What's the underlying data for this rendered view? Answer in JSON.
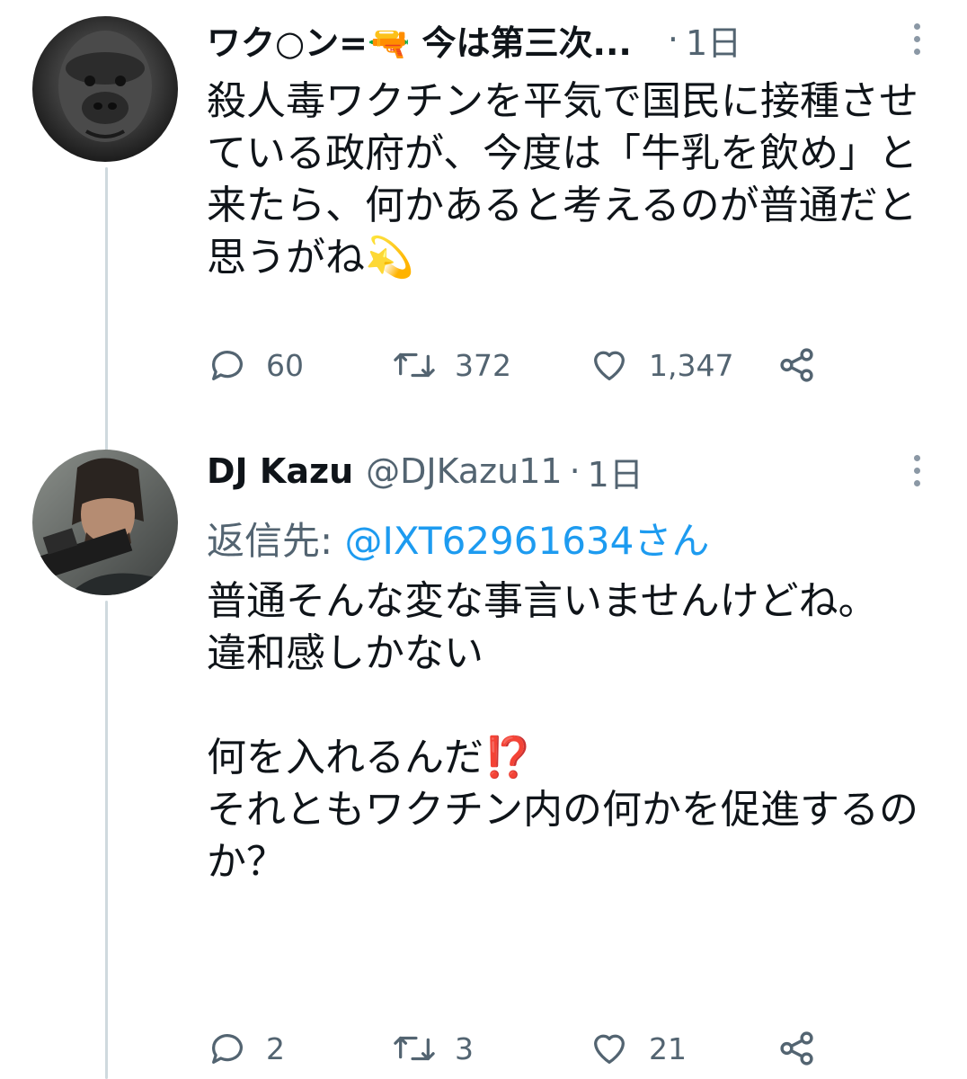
{
  "tweets": [
    {
      "name": "ワク○ン=🔫 今は第三次...",
      "handle": "",
      "time": "1日",
      "reply_label": "",
      "reply_mention": "",
      "text": "殺人毒ワクチンを平気で国民に接種させている政府が、今度は「牛乳を飲め」と来たら、何かあると考えるのが普通だと思うがね💫",
      "replies": "60",
      "retweets": "372",
      "likes": "1,347"
    },
    {
      "name": "DJ Kazu",
      "handle": "@DJKazu11",
      "time": "1日",
      "reply_label": "返信先: ",
      "reply_mention": "@IXT62961634さん",
      "text": "普通そんな変な事言いませんけどね。\n違和感しかない\n\n何を入れるんだ⁉️\nそれともワクチン内の何かを促進するのか？",
      "replies": "2",
      "retweets": "3",
      "likes": "21"
    }
  ],
  "icons": {
    "avatar1": "gorilla-photo",
    "avatar2": "man-with-gun-photo",
    "reply": "speech-bubble-icon",
    "retweet": "retweet-icon",
    "like": "heart-icon",
    "share": "share-icon",
    "more": "more-dots-icon"
  },
  "colors": {
    "link": "#1d9bf0",
    "secondary_text": "#536471",
    "thread_line": "#cfd9de"
  }
}
